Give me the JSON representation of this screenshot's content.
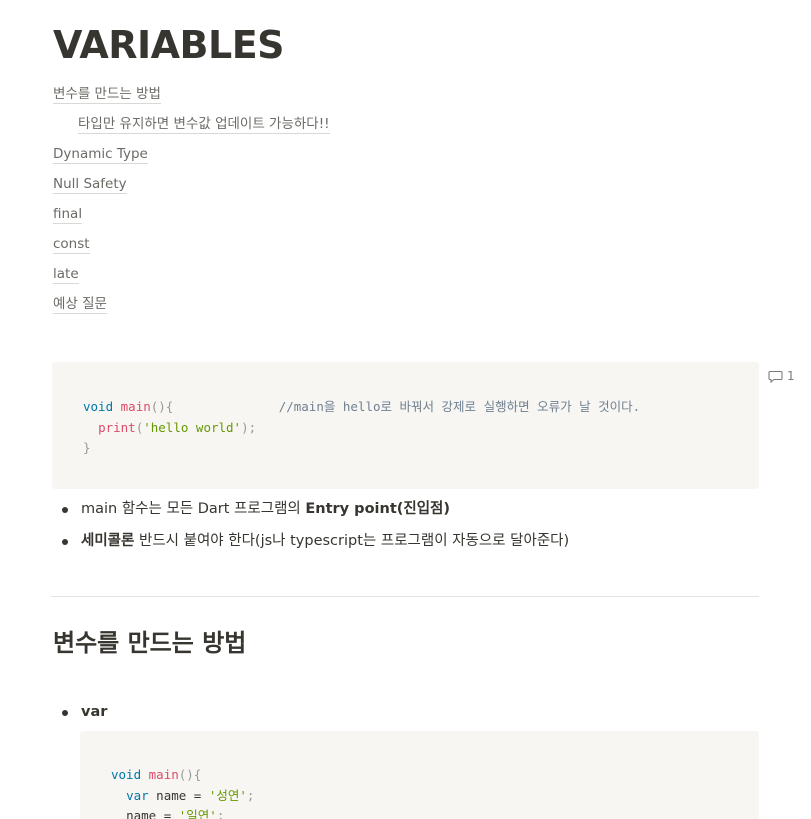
{
  "page": {
    "title": "VARIABLES"
  },
  "toc": [
    {
      "label": "변수를 만드는 방법"
    },
    {
      "label": "타입만 유지하면 변수값 업데이트 가능하다!!"
    },
    {
      "label": "Dynamic Type"
    },
    {
      "label": "Null Safety"
    },
    {
      "label": "final"
    },
    {
      "label": "const"
    },
    {
      "label": "late"
    },
    {
      "label": "예상 질문"
    }
  ],
  "code1": {
    "line1_kw": "void",
    "line1_fn": "main",
    "line1_punct": "(){",
    "line1_comment": "//main을 hello로 바꿔서 강제로 실행하면 오류가 날 것이다.",
    "line2_fn": "print",
    "line2_open": "(",
    "line2_str": "'hello world'",
    "line2_close": ");",
    "line3": "}"
  },
  "comment": {
    "count": "1"
  },
  "bullets": [
    {
      "pre": "main 함수는 모든 Dart 프로그램의 ",
      "bold": "Entry point(진입점)",
      "post": ""
    },
    {
      "pre": "",
      "bold": "세미콜론",
      "post": " 반드시 붙여야 한다(js나 typescript는 프로그램이 자동으로 달아준다)"
    }
  ],
  "section": {
    "heading": "변수를 만드는 방법"
  },
  "bullets2": [
    {
      "label": "var"
    }
  ],
  "code2": {
    "line1_kw": "void",
    "line1_fn": "main",
    "line1_punct": "(){",
    "line2_kw": "var",
    "line2_var": " name = ",
    "line2_str": "'성연'",
    "line2_end": ";",
    "line3_var": "name = ",
    "line3_str": "'일연'",
    "line3_end": ";"
  },
  "colors": {
    "text": "#37352f",
    "code_bg": "#f7f6f3",
    "keyword": "#0077aa",
    "function": "#dd4a68",
    "string": "#669900",
    "comment": "#708090"
  }
}
